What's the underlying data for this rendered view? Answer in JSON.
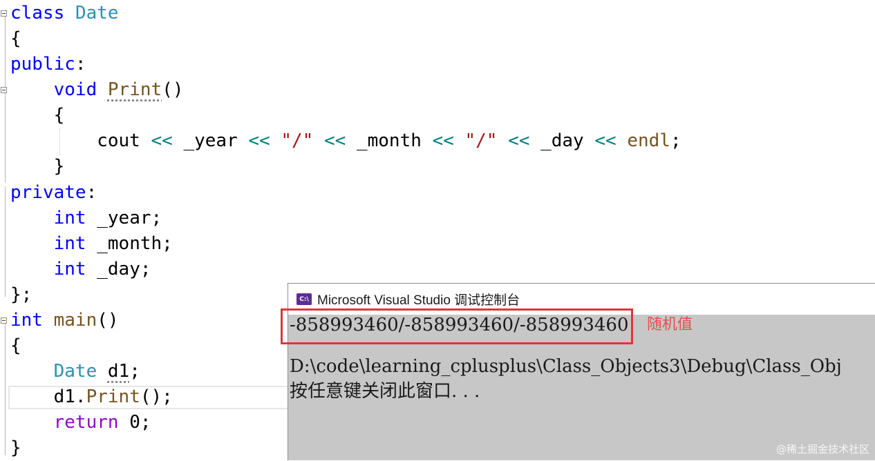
{
  "editor": {
    "lines": [
      {
        "tokens": [
          {
            "c": "kw",
            "t": "class"
          },
          {
            "c": "",
            "t": " "
          },
          {
            "c": "cls",
            "t": "Date"
          }
        ]
      },
      {
        "tokens": [
          {
            "c": "",
            "t": "{"
          }
        ]
      },
      {
        "tokens": [
          {
            "c": "kw",
            "t": "public"
          },
          {
            "c": "",
            "t": ":"
          }
        ]
      },
      {
        "tokens": [
          {
            "c": "",
            "t": "    "
          },
          {
            "c": "kw",
            "t": "void"
          },
          {
            "c": "",
            "t": " "
          },
          {
            "c": "fn squiggle",
            "t": "Print"
          },
          {
            "c": "",
            "t": "()"
          }
        ]
      },
      {
        "tokens": [
          {
            "c": "",
            "t": "    {"
          }
        ]
      },
      {
        "tokens": [
          {
            "c": "",
            "t": "        cout "
          },
          {
            "c": "op",
            "t": "<<"
          },
          {
            "c": "",
            "t": " _year "
          },
          {
            "c": "op",
            "t": "<<"
          },
          {
            "c": "",
            "t": " "
          },
          {
            "c": "str",
            "t": "\"/\""
          },
          {
            "c": "",
            "t": " "
          },
          {
            "c": "op",
            "t": "<<"
          },
          {
            "c": "",
            "t": " _month "
          },
          {
            "c": "op",
            "t": "<<"
          },
          {
            "c": "",
            "t": " "
          },
          {
            "c": "str",
            "t": "\"/\""
          },
          {
            "c": "",
            "t": " "
          },
          {
            "c": "op",
            "t": "<<"
          },
          {
            "c": "",
            "t": " _day "
          },
          {
            "c": "op",
            "t": "<<"
          },
          {
            "c": "",
            "t": " "
          },
          {
            "c": "fn",
            "t": "endl"
          },
          {
            "c": "",
            "t": ";"
          }
        ]
      },
      {
        "tokens": [
          {
            "c": "",
            "t": "    }"
          }
        ]
      },
      {
        "tokens": [
          {
            "c": "kw",
            "t": "private"
          },
          {
            "c": "",
            "t": ":"
          }
        ]
      },
      {
        "tokens": [
          {
            "c": "",
            "t": "    "
          },
          {
            "c": "kw",
            "t": "int"
          },
          {
            "c": "",
            "t": " _year;"
          }
        ]
      },
      {
        "tokens": [
          {
            "c": "",
            "t": "    "
          },
          {
            "c": "kw",
            "t": "int"
          },
          {
            "c": "",
            "t": " _month;"
          }
        ]
      },
      {
        "tokens": [
          {
            "c": "",
            "t": "    "
          },
          {
            "c": "kw",
            "t": "int"
          },
          {
            "c": "",
            "t": " _day;"
          }
        ]
      },
      {
        "tokens": [
          {
            "c": "",
            "t": "};"
          }
        ]
      },
      {
        "tokens": [
          {
            "c": "kw",
            "t": "int"
          },
          {
            "c": "",
            "t": " "
          },
          {
            "c": "fn",
            "t": "main"
          },
          {
            "c": "",
            "t": "()"
          }
        ]
      },
      {
        "tokens": [
          {
            "c": "",
            "t": "{"
          }
        ]
      },
      {
        "tokens": [
          {
            "c": "",
            "t": "    "
          },
          {
            "c": "cls",
            "t": "Date"
          },
          {
            "c": "",
            "t": " "
          },
          {
            "c": "squiggle",
            "t": "d1"
          },
          {
            "c": "",
            "t": ";"
          }
        ]
      },
      {
        "tokens": [
          {
            "c": "",
            "t": "    d1."
          },
          {
            "c": "fn",
            "t": "Print"
          },
          {
            "c": "",
            "t": "();"
          }
        ]
      },
      {
        "tokens": [
          {
            "c": "",
            "t": "    "
          },
          {
            "c": "ret",
            "t": "return"
          },
          {
            "c": "",
            "t": " 0;"
          }
        ]
      },
      {
        "tokens": [
          {
            "c": "",
            "t": "}"
          }
        ]
      }
    ]
  },
  "console": {
    "title": "Microsoft Visual Studio 调试控制台",
    "icon": "vs-console-icon",
    "icon_text": "C:\\",
    "output_line": "-858993460/-858993460/-858993460",
    "path_line": "D:\\code\\learning_cplusplus\\Class_Objects3\\Debug\\Class_Obj",
    "prompt_line": "按任意键关闭此窗口. . ."
  },
  "annotation": {
    "label": "随机值",
    "color": "#e0343a"
  },
  "watermark": "@稀土掘金技术社区"
}
